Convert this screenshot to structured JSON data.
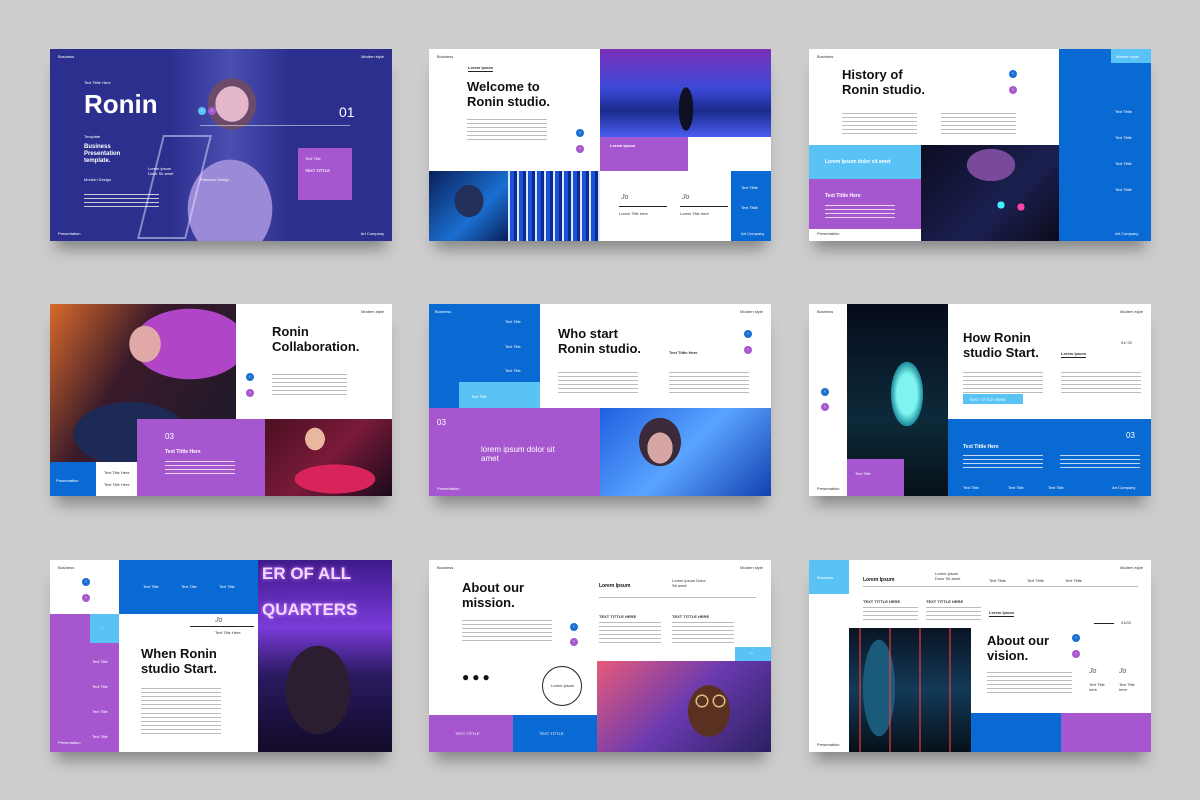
{
  "colors": {
    "blue": "#0a6ad4",
    "purple": "#a656cf",
    "sky": "#59c3f6",
    "navy": "#2a2f8a",
    "bg": "#cdcdcd"
  },
  "s1": {
    "top_left": "Business",
    "top_right": "Modern style",
    "kicker": "Text Tittle Here",
    "title": "Ronin",
    "number": "01",
    "sub1": "Template",
    "sub2": "Business Presentation template.",
    "sub3": "Modern Design",
    "sub4": "Lorem ipsum Dolor Sit amet",
    "sub5": "Premium Design",
    "box_label1": "Text Title",
    "box_label2": "TEXT TITTLE",
    "bottom_left": "Presentation",
    "bottom_right": "Art Company"
  },
  "s2": {
    "top_left": "Business",
    "kicker": "Lorem Ipsum",
    "title": "Welcome to Ronin studio.",
    "bar": "Lorem Ipsum",
    "jo1": "Jo",
    "jo2": "Jo",
    "col1": "Lorem Title here",
    "col2": "Lorem Title here",
    "side1": "Text Tittle",
    "side2": "Text Tittle",
    "bottom_right": "Art Company"
  },
  "s3": {
    "top_left": "Business",
    "top_right": "Modern style",
    "title": "History of Ronin studio.",
    "items": [
      "Text Tittle",
      "Text Tittle",
      "Text Tittle",
      "Text Tittle"
    ],
    "sky_bar": "Lorem Ipsum dolor sit amet",
    "purple_bar": "Text Tittle Here",
    "bottom_left": "Presentation",
    "bottom_right": "Art Company"
  },
  "s4": {
    "top_right": "Modern style",
    "title": "Ronin Collaboration.",
    "number": "03",
    "label": "Text Tittle Here",
    "box1": "Text Title Here",
    "box2": "Text Title Here",
    "bottom_left": "Presentation"
  },
  "s5": {
    "top_left": "Business",
    "top_right": "Modern style",
    "items": [
      "Text Title",
      "Text Title",
      "Text Title"
    ],
    "sky_label": "Text Title",
    "title": "Who start Ronin studio.",
    "kicker": "Text Tittle Here",
    "number": "03",
    "purple_text": "lorem ipsum dolor sit amet",
    "bottom_left": "Presentation"
  },
  "s6": {
    "top_left": "Business",
    "top_right": "Modern style",
    "title": "How Ronin studio Start.",
    "kicker": "Lorem Ipsum",
    "page": "01/ 02",
    "button": "TEXT TITTLE HERE",
    "blue_title": "Text Tittle Here",
    "number": "03",
    "side_label": "Text Title",
    "foot_items": [
      "Text Title",
      "Text Title",
      "Text Title"
    ],
    "bottom_left": "Presentation",
    "bottom_right": "Art Company"
  },
  "s7": {
    "top_left": "Business",
    "top_items": [
      "Text Title",
      "Text Title",
      "Text Title"
    ],
    "jo": "Jo",
    "jo_label": "Text Title Here",
    "title": "When Ronin studio Start.",
    "side_items": [
      "Text Title",
      "Text Title",
      "Text Title",
      "Text Title"
    ],
    "bottom_left": "Presentation",
    "neon": [
      "ER OF ALL",
      "QUARTERS"
    ]
  },
  "s8": {
    "top_left": "Business",
    "top_right": "Modern style",
    "title": "About our mission.",
    "kicker": "Lorem Ipsum",
    "col_title": "Lorem ipsum Dolor Sit amet",
    "th1": "TEXT TITTLE HERE",
    "th2": "TEXT TITTLE HERE",
    "circle": "Lorem Ipsum",
    "arrow": "←",
    "foot1": "TEXT TITTLE",
    "foot2": "TEXT TITTLE"
  },
  "s9": {
    "top_right": "Modern style",
    "sky_label": "Business",
    "kicker": "Lorem Ipsum",
    "kicker2": "Lorem Ipsum Dolor Sit amet",
    "top_items": [
      "Text Tittle",
      "Text Tittle",
      "Text Tittle"
    ],
    "th1": "TEXT TITTLE HERE",
    "th2": "TEXT TITTLE HERE",
    "kicker3": "Lorem Ipsum",
    "page": "01/02",
    "title": "About our vision.",
    "jo1": "Jo",
    "jo2": "Jo",
    "lab1": "Text Title here",
    "lab2": "Text Title here",
    "bottom_left": "Presentation"
  }
}
